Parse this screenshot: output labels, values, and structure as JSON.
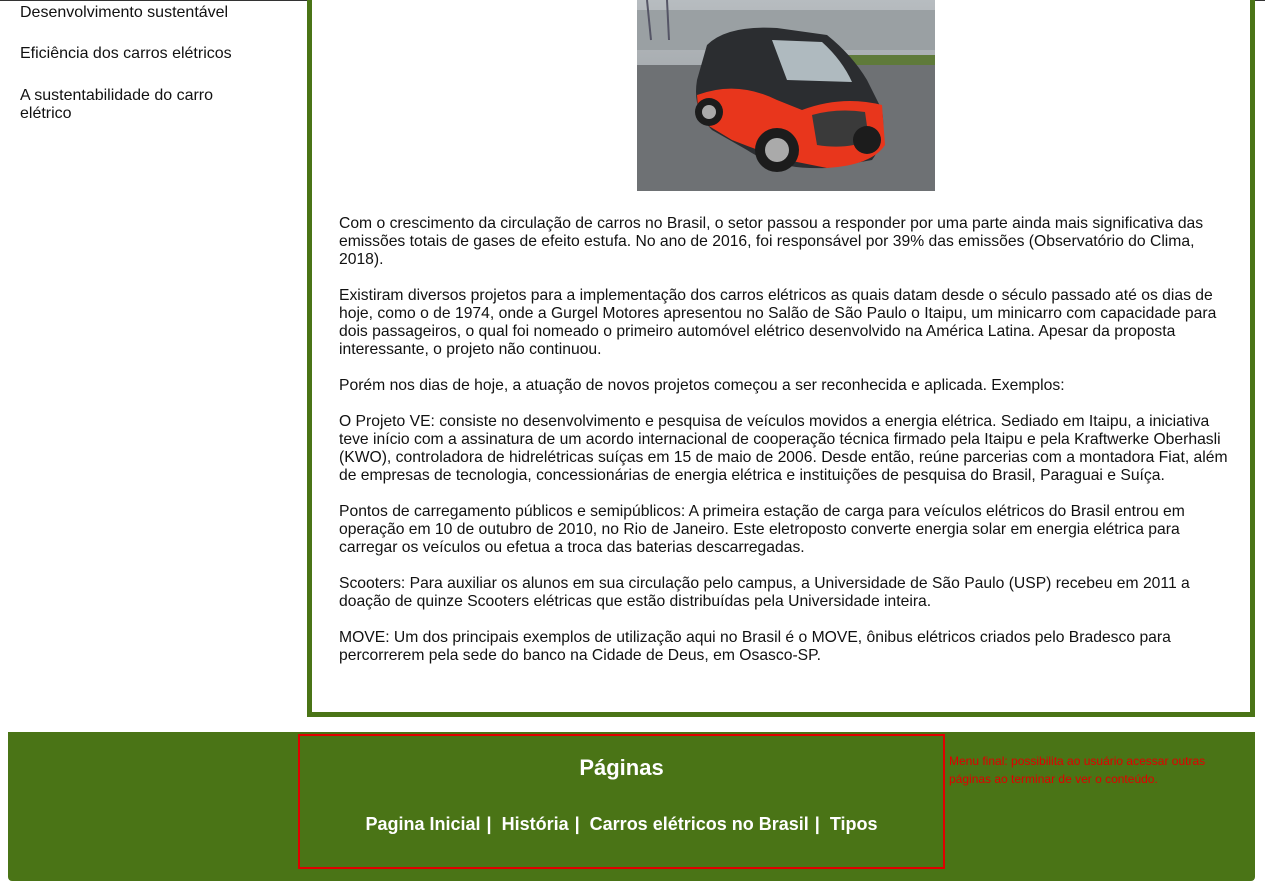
{
  "sidebar": {
    "items": [
      {
        "label": "Desenvolvimento sustentável"
      },
      {
        "label": "Eficiência dos carros elétricos"
      },
      {
        "label": "A sustentabilidade do carro elétrico"
      }
    ]
  },
  "main": {
    "paragraphs": [
      "Com o crescimento da circulação de carros no Brasil, o setor passou a responder por uma parte ainda mais significativa das emissões totais de gases de efeito estufa. No ano de 2016, foi responsável por 39% das emissões (Observatório do Clima, 2018).",
      "Existiram diversos projetos para a implementação dos carros elétricos as quais datam desde o século passado até os dias de hoje, como o de 1974, onde a Gurgel Motores apresentou no Salão de São Paulo o Itaipu, um minicarro com capacidade para dois passageiros, o qual foi nomeado o primeiro automóvel elétrico desenvolvido na América Latina. Apesar da proposta interessante, o projeto não continuou.",
      "Porém nos dias de hoje, a atuação de novos projetos começou a ser reconhecida e aplicada. Exemplos:",
      "O Projeto VE: consiste no desenvolvimento e pesquisa de veículos movidos a energia elétrica. Sediado em Itaipu, a iniciativa teve início com a assinatura de um acordo internacional de cooperação técnica firmado pela Itaipu e pela Kraftwerke Oberhasli (KWO), controladora de hidrelétricas suíças em 15 de maio de 2006. Desde então, reúne parcerias com a montadora Fiat, além de empresas de tecnologia, concessionárias de energia elétrica e instituições de pesquisa do Brasil, Paraguai e Suíça.",
      "Pontos de carregamento públicos e semipúblicos: A primeira estação de carga para veículos elétricos do Brasil entrou em operação em 10 de outubro de 2010, no Rio de Janeiro. Este eletroposto converte energia solar em energia elétrica para carregar os veículos ou efetua a troca das baterias descarregadas.",
      "Scooters: Para auxiliar os alunos em sua circulação pelo campus, a Universidade de São Paulo (USP) recebeu em 2011 a doação de quinze Scooters elétricas que estão distribuídas pela Universidade inteira.",
      "MOVE: Um dos principais exemplos de utilização aqui no Brasil é o MOVE, ônibus elétricos criados pelo Bradesco para percorrerem pela sede do banco na Cidade de Deus, em Osasco-SP."
    ]
  },
  "footer": {
    "title": "Páginas",
    "links": [
      {
        "label": "Pagina Inicial",
        "sep": "|"
      },
      {
        "label": "História",
        "sep": "|"
      },
      {
        "label": "Carros elétricos no Brasil",
        "sep": "|"
      },
      {
        "label": "Tipos",
        "sep": ""
      }
    ],
    "note": "Menu final: possibilita ao usuário acessar outras páginas ao terminar de ver o conteúdo."
  },
  "colors": {
    "accent_green": "#4a7416",
    "annotation_red": "#e00000"
  }
}
